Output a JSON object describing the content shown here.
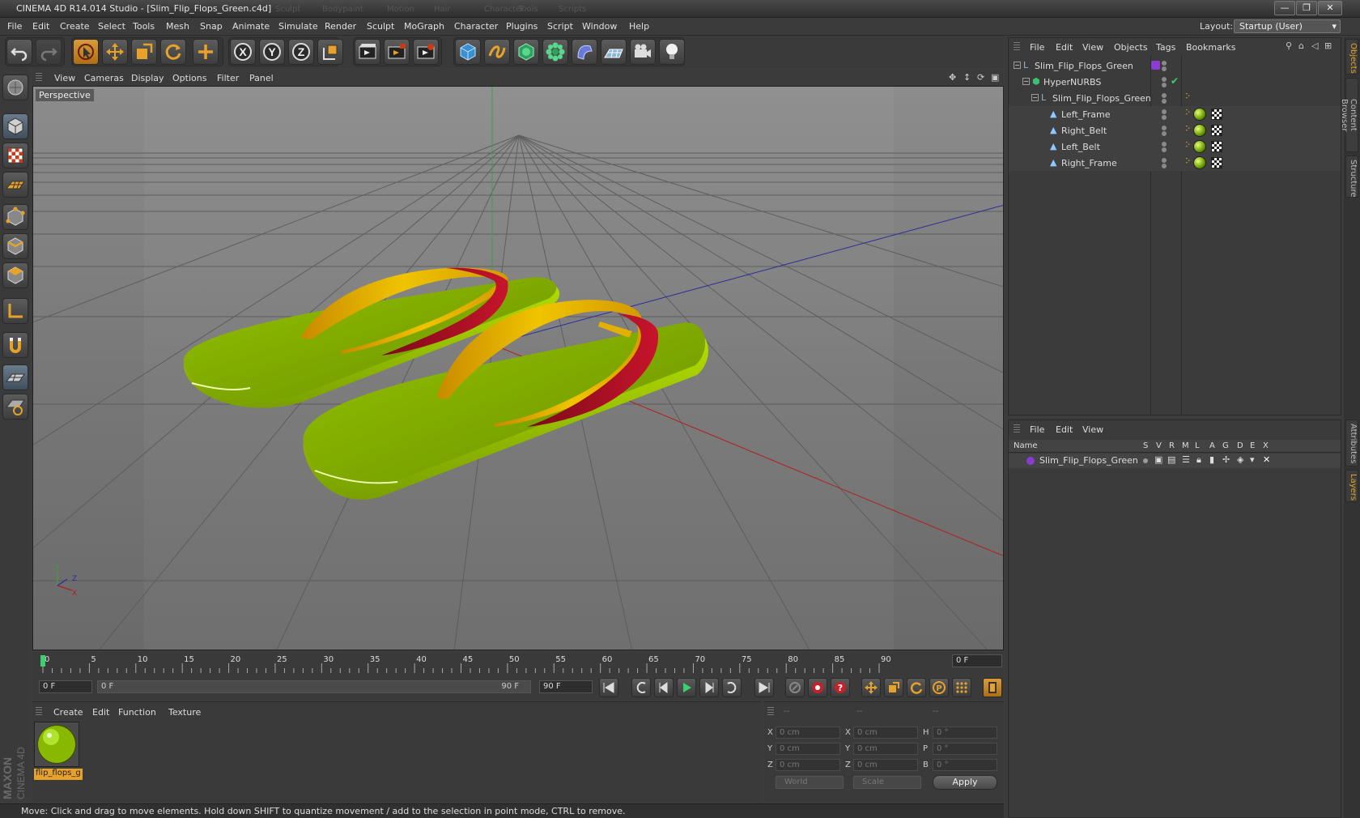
{
  "window": {
    "title": "CINEMA 4D R14.014 Studio - [Slim_Flip_Flops_Green.c4d]",
    "ghost_menu": [
      "Sculpt",
      "Bodypaint",
      "Motion",
      "Hair",
      "Character",
      "Tools",
      "Scripts"
    ],
    "buttons": {
      "minimize": "—",
      "restore": "❐",
      "close": "✕"
    }
  },
  "menubar": {
    "items": [
      "File",
      "Edit",
      "Create",
      "Select",
      "Tools",
      "Mesh",
      "Snap",
      "Animate",
      "Simulate",
      "Render",
      "Sculpt",
      "MoGraph",
      "Character",
      "Plugins",
      "Script",
      "Window",
      "Help"
    ],
    "layout_label": "Layout:",
    "layout_value": "Startup (User)"
  },
  "toolbar": {
    "icons": [
      "undo-icon",
      "redo-icon",
      "live-selection-icon",
      "move-icon",
      "scale-icon",
      "rotate-icon",
      "add-icon",
      "x-axis-icon",
      "y-axis-icon",
      "z-axis-icon",
      "world-coordinates-icon",
      "render-view-icon",
      "render-picture-viewer-icon",
      "edit-render-settings-icon",
      "cube-icon",
      "spline-pen-icon",
      "subdivision-surface-icon",
      "array-icon",
      "deformer-icon",
      "floor-icon",
      "camera-icon",
      "light-icon"
    ],
    "axis_labels": [
      "X",
      "Y",
      "Z"
    ]
  },
  "left_tools": [
    "make-editable-icon",
    "model-mode-icon",
    "texture-mode-icon",
    "workplane-mode-icon",
    "points-mode-icon",
    "edges-mode-icon",
    "polygons-mode-icon",
    "axis-mode-icon",
    "tweak-mode-icon",
    "workplane-snap-icon",
    "locked-workplane-icon"
  ],
  "viewport": {
    "menu": [
      "View",
      "Cameras",
      "Display",
      "Options",
      "Filter",
      "Panel"
    ],
    "camera_label": "Perspective",
    "axis_gizmo": {
      "x": "X",
      "y": "Y",
      "z": "Z"
    }
  },
  "timeline": {
    "ticks": [
      "0",
      "5",
      "10",
      "15",
      "20",
      "25",
      "30",
      "35",
      "40",
      "45",
      "50",
      "55",
      "60",
      "65",
      "70",
      "75",
      "80",
      "85",
      "90"
    ],
    "current_frame": "0 F",
    "start_field": "0 F",
    "range_start": "0 F",
    "range_end": "90 F",
    "end_field": "90 F"
  },
  "material_manager": {
    "menu": [
      "Create",
      "Edit",
      "Function",
      "Texture"
    ],
    "materials": [
      {
        "name": "flip_flops_g"
      }
    ]
  },
  "coordinates": {
    "headers": [
      "--",
      "--",
      "--"
    ],
    "rows": [
      {
        "pos_label": "X",
        "pos": "0 cm",
        "size_label": "X",
        "size": "0 cm",
        "rot_label": "H",
        "rot": "0 °"
      },
      {
        "pos_label": "Y",
        "pos": "0 cm",
        "size_label": "Y",
        "size": "0 cm",
        "rot_label": "P",
        "rot": "0 °"
      },
      {
        "pos_label": "Z",
        "pos": "0 cm",
        "size_label": "Z",
        "size": "0 cm",
        "rot_label": "B",
        "rot": "0 °"
      }
    ],
    "mode_world": "World",
    "mode_scale": "Scale",
    "apply_label": "Apply"
  },
  "status": {
    "text": "Move: Click and drag to move elements. Hold down SHIFT to quantize movement / add to the selection in point mode, CTRL to remove."
  },
  "branding": {
    "line1": "MAXON",
    "line2": "CINEMA 4D"
  },
  "object_manager": {
    "menu": [
      "File",
      "Edit",
      "View",
      "Objects",
      "Tags",
      "Bookmarks"
    ],
    "objects": [
      {
        "name": "Slim_Flip_Flops_Green",
        "indent": 0,
        "type": "null"
      },
      {
        "name": "HyperNURBS",
        "indent": 1,
        "type": "hypernurbs"
      },
      {
        "name": "Slim_Flip_Flops_Green",
        "indent": 2,
        "type": "null"
      },
      {
        "name": "Left_Frame",
        "indent": 3,
        "type": "polygon"
      },
      {
        "name": "Right_Belt",
        "indent": 3,
        "type": "polygon"
      },
      {
        "name": "Left_Belt",
        "indent": 3,
        "type": "polygon"
      },
      {
        "name": "Right_Frame",
        "indent": 3,
        "type": "polygon"
      }
    ]
  },
  "layer_manager": {
    "menu": [
      "File",
      "Edit",
      "View"
    ],
    "columns": [
      "Name",
      "S",
      "V",
      "R",
      "M",
      "L",
      "A",
      "G",
      "D",
      "E",
      "X"
    ],
    "layers": [
      {
        "name": "Slim_Flip_Flops_Green",
        "color": "#8a3ccf"
      }
    ]
  },
  "right_tabs": [
    "Objects",
    "Content Browser",
    "Structure",
    "Attributes",
    "Layers"
  ],
  "colors": {
    "accent": "#e6a22a",
    "sole": "#9ac800",
    "strap_yellow": "#e2b000",
    "strap_red": "#b8102a",
    "viewport_bg": "#7a7a7a"
  }
}
